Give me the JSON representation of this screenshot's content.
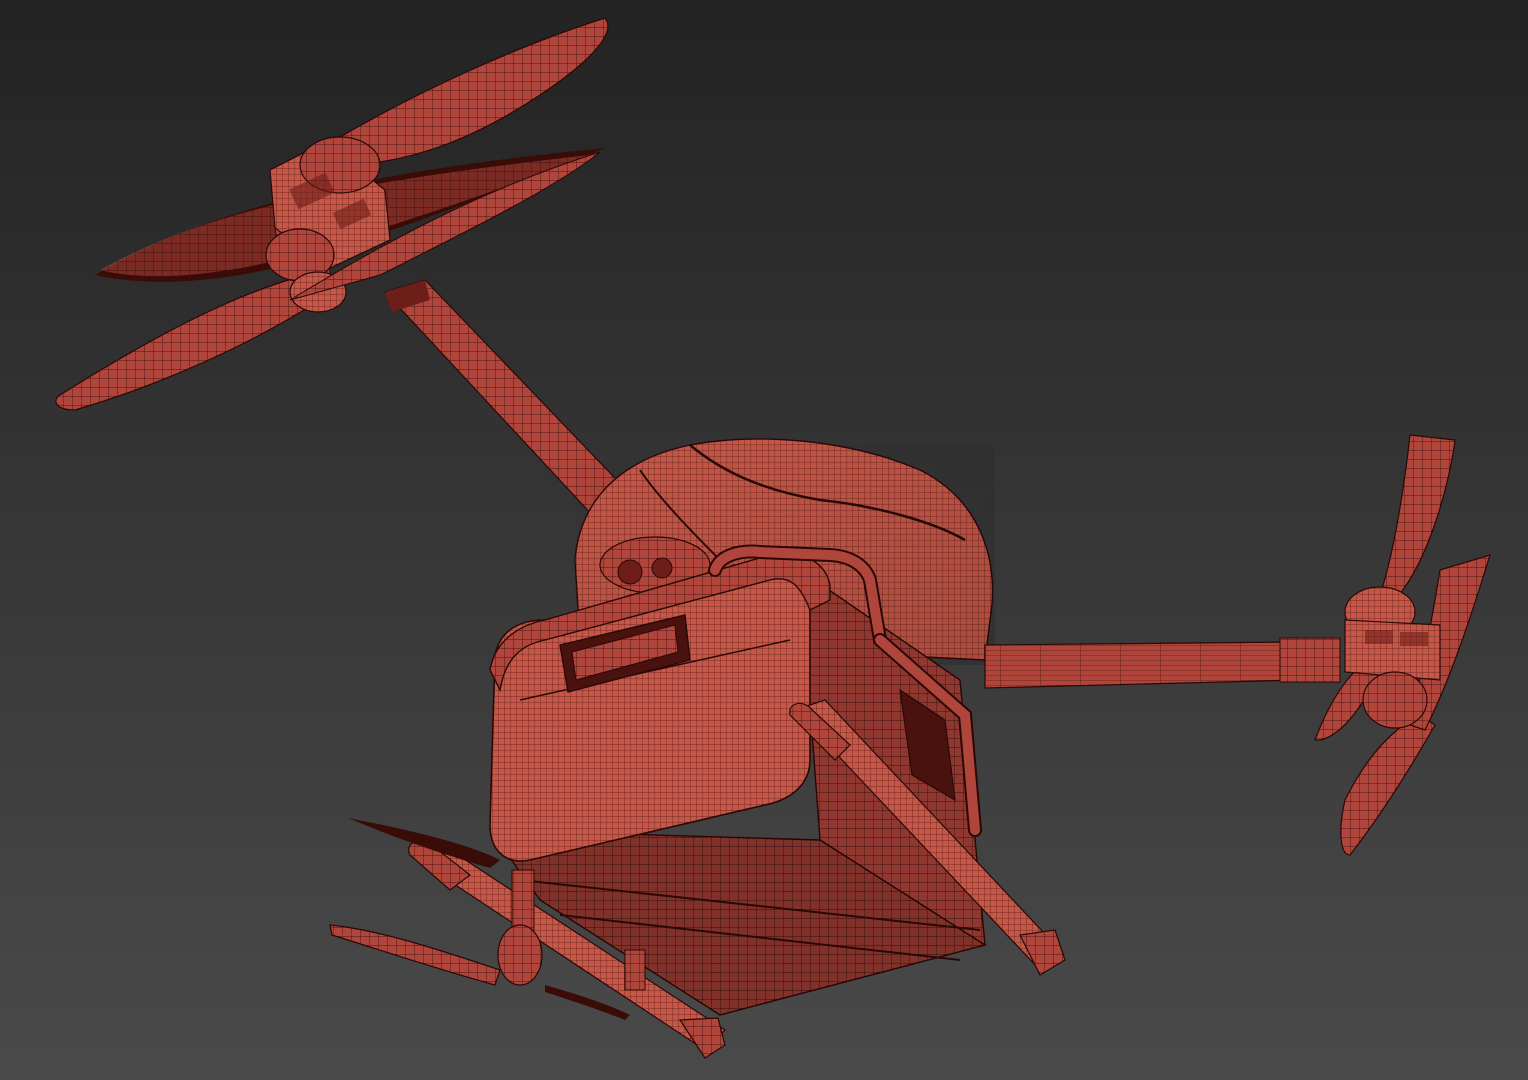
{
  "scene": {
    "subject_icon": "drone-wireframe-icon",
    "colors": {
      "background_top": "#232323",
      "background_bottom": "#4a4a4a",
      "mesh_fill": "#b0453b",
      "mesh_fill_light": "#c85646",
      "mesh_shadow": "#6e1e18",
      "wire": "#2a0806",
      "blade_dark": "#3a0c08"
    }
  }
}
